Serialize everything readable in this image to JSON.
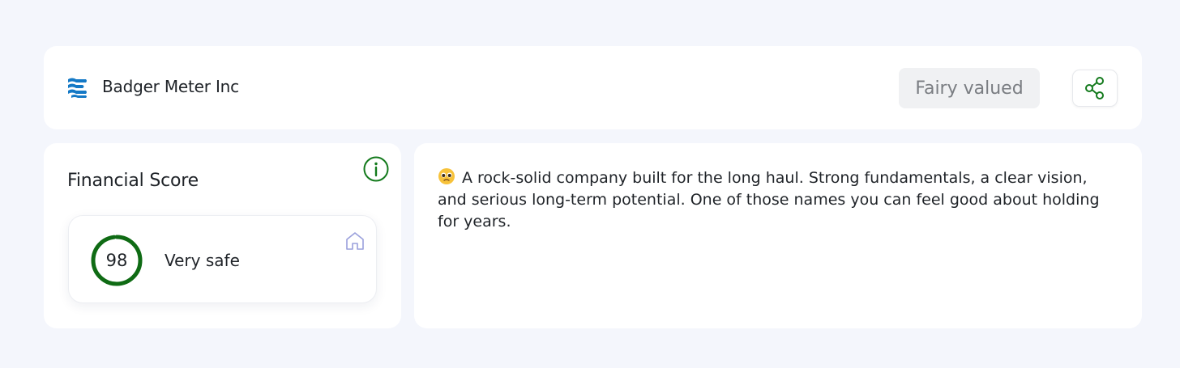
{
  "header": {
    "company_name": "Badger Meter Inc",
    "logo_icon": "badger-meter-logo",
    "valuation_label": "Fairy valued",
    "share_icon": "share-icon"
  },
  "score": {
    "title": "Financial Score",
    "value": "98",
    "percent": 98,
    "rating": "Very safe",
    "info_icon": "info-icon",
    "category_icon": "home-icon"
  },
  "summary": {
    "emoji": "pleading-face-emoji",
    "text": "A rock-solid company built for the long haul. Strong fundamentals, a clear vision, and serious long-term potential. One of those names you can feel good about holding for years."
  },
  "colors": {
    "page_bg": "#f4f6fc",
    "card_bg": "#ffffff",
    "accent_green": "#137a1c",
    "gauge_green": "#0f6b14",
    "logo_blue": "#1479c6",
    "badge_bg": "#f0f1f3",
    "badge_text": "#7a7d82",
    "home_icon": "#9aa0dc"
  }
}
